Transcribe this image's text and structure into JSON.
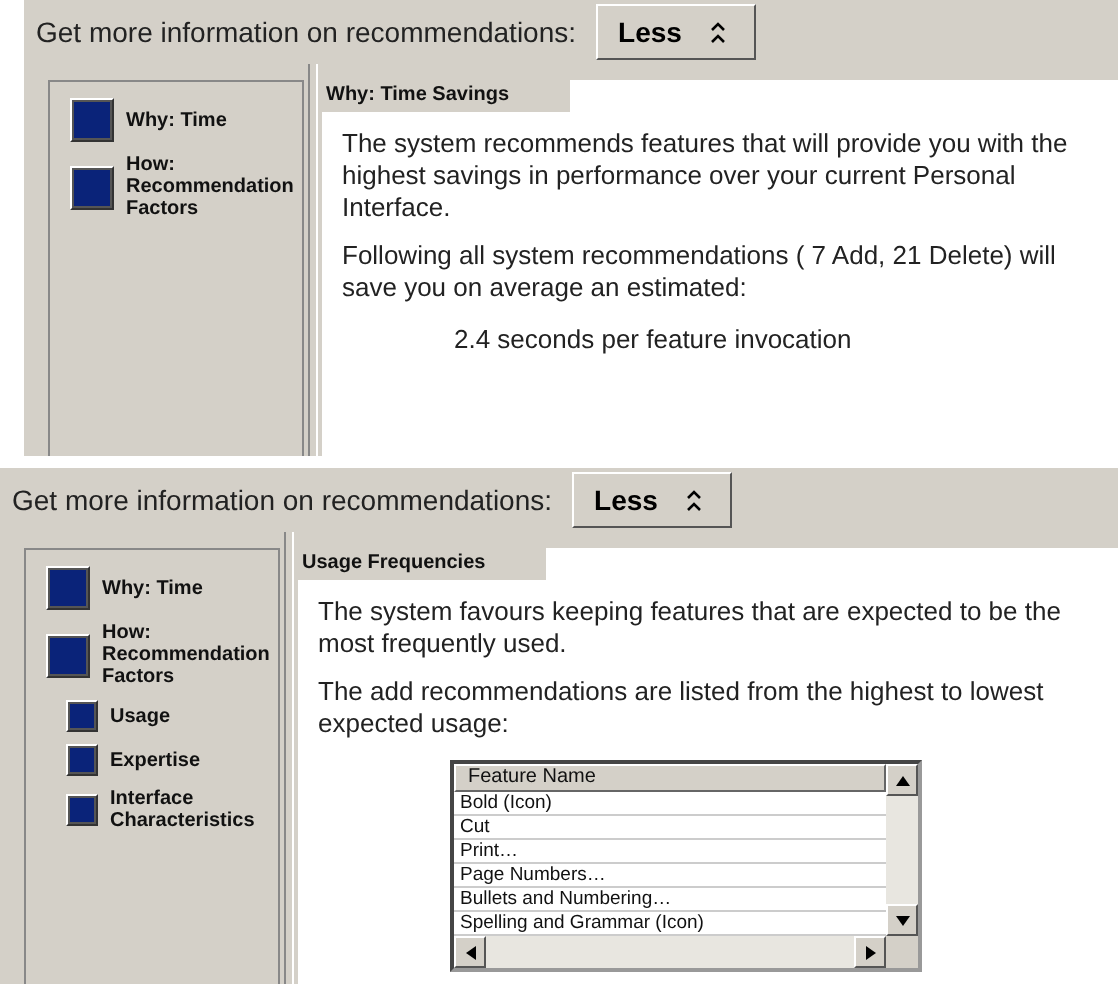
{
  "panels": [
    {
      "prompt": "Get more information on recommendations:",
      "toggle": "Less",
      "nav": [
        {
          "kind": "large",
          "label": "Why: Time"
        },
        {
          "kind": "large",
          "label": "How: Recommendation Factors"
        }
      ],
      "tab": "Why: Time Savings",
      "paragraphs": [
        {
          "kind": "text",
          "text": "The system recommends features that will provide you with the highest savings in performance over your current Personal Interface."
        },
        {
          "kind": "text",
          "text": "Following all system recommendations ( 7   Add,  21 Delete) will save you on average an estimated:"
        },
        {
          "kind": "result",
          "text": "2.4 seconds per feature invocation"
        }
      ]
    },
    {
      "prompt": "Get more information on recommendations:",
      "toggle": "Less",
      "nav": [
        {
          "kind": "large",
          "label": "Why: Time"
        },
        {
          "kind": "large",
          "label": "How: Recommendation Factors"
        },
        {
          "kind": "small",
          "label": "Usage"
        },
        {
          "kind": "small",
          "label": "Expertise"
        },
        {
          "kind": "small",
          "label": "Interface Characteristics"
        }
      ],
      "tab": "Usage Frequencies",
      "paragraphs": [
        {
          "kind": "text",
          "text": "The system favours keeping features that are expected to be the most frequently used."
        },
        {
          "kind": "text",
          "text": "The add recommendations are listed from the highest to lowest expected usage:"
        }
      ],
      "list": {
        "column": "Feature Name",
        "rows": [
          "Bold (Icon)",
          "Cut",
          "Print…",
          "Page Numbers…",
          "Bullets and Numbering…",
          "Spelling and Grammar (Icon)"
        ]
      }
    }
  ]
}
